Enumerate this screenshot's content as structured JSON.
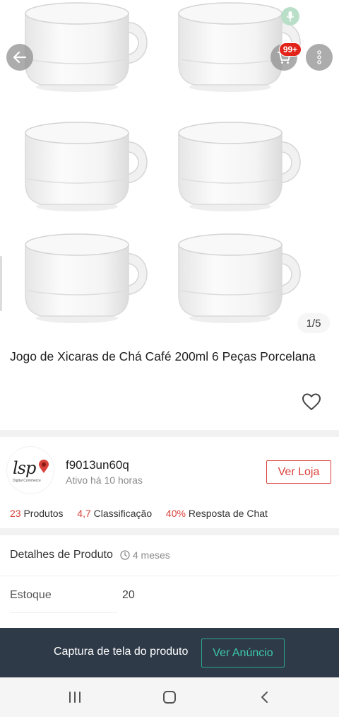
{
  "gallery": {
    "page_indicator": "1/5"
  },
  "header": {
    "cart_badge": "99+"
  },
  "product": {
    "title": "Jogo de Xicaras de Chá Café 200ml 6 Peças Porcelana"
  },
  "store": {
    "logo_text": "lsp",
    "logo_subtext": "Digital Commerce",
    "name": "f9013un60q",
    "active_status": "Ativo há 10 horas",
    "visit_label": "Ver Loja",
    "stats": {
      "products_count": "23",
      "products_label": "Produtos",
      "rating_value": "4,7",
      "rating_label": "Classificação",
      "chat_rate": "40%",
      "chat_label": "Resposta de Chat"
    }
  },
  "details": {
    "title": "Detalhes de Produto",
    "time_ago": "4 meses",
    "stock_label": "Estoque",
    "stock_value": "20"
  },
  "capture_bar": {
    "text": "Captura de tela do produto",
    "button_label": "Ver Anúncio"
  },
  "colors": {
    "accent": "#d9403a",
    "capture_bg": "#2f3a48",
    "capture_accent": "#2ba58e",
    "badge": "#e2231a"
  },
  "icons": [
    "back-arrow-icon",
    "mic-icon",
    "cart-icon",
    "more-options-icon",
    "heart-icon",
    "clock-icon",
    "recent-apps-icon",
    "home-icon",
    "back-icon"
  ]
}
